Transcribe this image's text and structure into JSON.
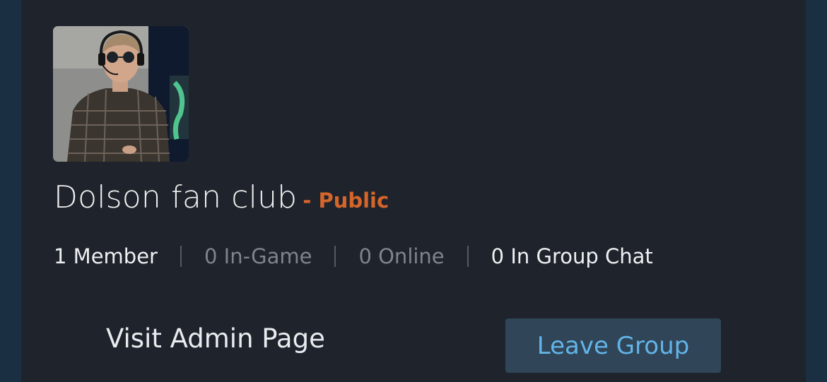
{
  "group": {
    "name": "Dolson fan club",
    "privacy": "- Public",
    "avatar_icon": "group-avatar-photo"
  },
  "stats": {
    "members": "1 Member",
    "in_game": "0 In-Game",
    "online": "0 Online",
    "in_group_chat": "0 In Group Chat"
  },
  "actions": {
    "admin_label": "Visit Admin Page",
    "leave_label": "Leave Group"
  },
  "colors": {
    "card_bg": "#1f232b",
    "page_bg": "#1b2f42",
    "privacy_accent": "#d4652b",
    "button_bg": "#304558",
    "button_text": "#62b4e8"
  }
}
